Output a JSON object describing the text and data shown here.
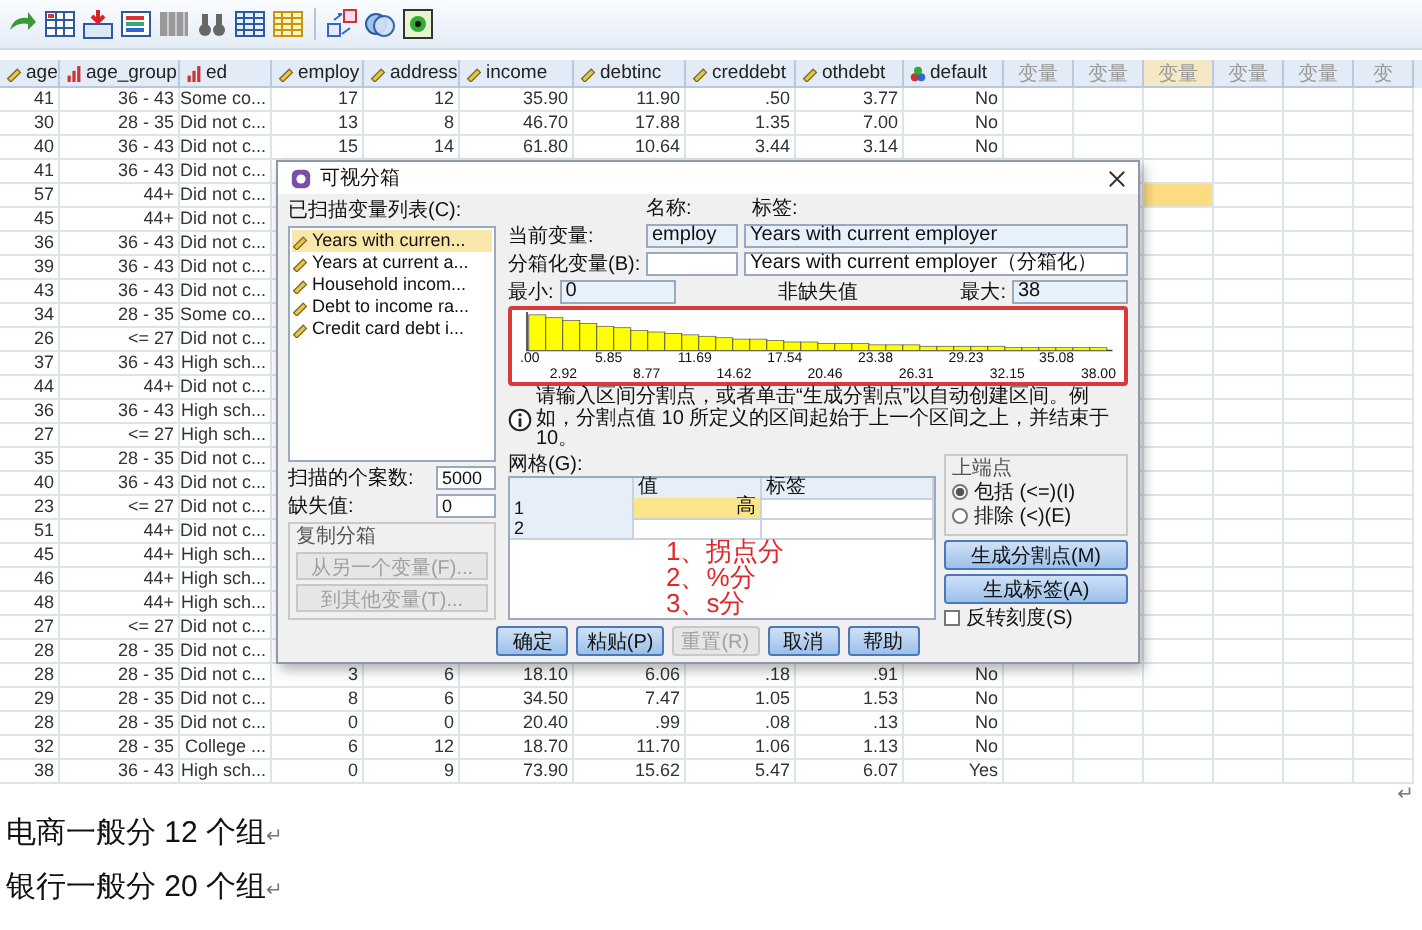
{
  "data_grid": {
    "columns": [
      {
        "name": "age",
        "kind": "scale"
      },
      {
        "name": "age_group",
        "kind": "ordinal"
      },
      {
        "name": "ed",
        "kind": "ordinal"
      },
      {
        "name": "employ",
        "kind": "scale"
      },
      {
        "name": "address",
        "kind": "scale"
      },
      {
        "name": "income",
        "kind": "scale"
      },
      {
        "name": "debtinc",
        "kind": "scale"
      },
      {
        "name": "creddebt",
        "kind": "scale"
      },
      {
        "name": "othdebt",
        "kind": "scale"
      },
      {
        "name": "default",
        "kind": "nominal"
      },
      {
        "name": "变量",
        "kind": "blank",
        "cursor": false
      },
      {
        "name": "变量",
        "kind": "blank",
        "cursor": false
      },
      {
        "name": "变量",
        "kind": "blank",
        "cursor": true
      },
      {
        "name": "变量",
        "kind": "blank",
        "cursor": false
      },
      {
        "name": "变量",
        "kind": "blank",
        "cursor": false
      },
      {
        "name": "变",
        "kind": "blank",
        "cursor": false
      }
    ],
    "rows": [
      {
        "cells": [
          "41",
          "36 - 43",
          "Some co...",
          "17",
          "12",
          "35.90",
          "11.90",
          ".50",
          "3.77",
          "No"
        ],
        "cursor": false
      },
      {
        "cells": [
          "30",
          "28 - 35",
          "Did not c...",
          "13",
          "8",
          "46.70",
          "17.88",
          "1.35",
          "7.00",
          "No"
        ],
        "cursor": false
      },
      {
        "cells": [
          "40",
          "36 - 43",
          "Did not c...",
          "15",
          "14",
          "61.80",
          "10.64",
          "3.44",
          "3.14",
          "No"
        ],
        "cursor": false
      },
      {
        "cells": [
          "41",
          "36 - 43",
          "Did not c..."
        ],
        "cursor": false
      },
      {
        "cells": [
          "57",
          "44+",
          "Did not c..."
        ],
        "cursor": true
      },
      {
        "cells": [
          "45",
          "44+",
          "Did not c..."
        ],
        "cursor": false
      },
      {
        "cells": [
          "36",
          "36 - 43",
          "Did not c..."
        ],
        "cursor": false
      },
      {
        "cells": [
          "39",
          "36 - 43",
          "Did not c..."
        ],
        "cursor": false
      },
      {
        "cells": [
          "43",
          "36 - 43",
          "Did not c..."
        ],
        "cursor": false
      },
      {
        "cells": [
          "34",
          "28 - 35",
          "Some co..."
        ],
        "cursor": false
      },
      {
        "cells": [
          "26",
          "<= 27",
          "Did not c..."
        ],
        "cursor": false
      },
      {
        "cells": [
          "37",
          "36 - 43",
          "High sch..."
        ],
        "cursor": false
      },
      {
        "cells": [
          "44",
          "44+",
          "Did not c..."
        ],
        "cursor": false
      },
      {
        "cells": [
          "36",
          "36 - 43",
          "High sch..."
        ],
        "cursor": false
      },
      {
        "cells": [
          "27",
          "<= 27",
          "High sch..."
        ],
        "cursor": false
      },
      {
        "cells": [
          "35",
          "28 - 35",
          "Did not c..."
        ],
        "cursor": false
      },
      {
        "cells": [
          "40",
          "36 - 43",
          "Did not c..."
        ],
        "cursor": false
      },
      {
        "cells": [
          "23",
          "<= 27",
          "Did not c..."
        ],
        "cursor": false
      },
      {
        "cells": [
          "51",
          "44+",
          "Did not c..."
        ],
        "cursor": false
      },
      {
        "cells": [
          "45",
          "44+",
          "High sch..."
        ],
        "cursor": false
      },
      {
        "cells": [
          "46",
          "44+",
          "High sch..."
        ],
        "cursor": false
      },
      {
        "cells": [
          "48",
          "44+",
          "High sch..."
        ],
        "cursor": false
      },
      {
        "cells": [
          "27",
          "<= 27",
          "Did not c..."
        ],
        "cursor": false
      },
      {
        "cells": [
          "28",
          "28 - 35",
          "Did not c..."
        ],
        "cursor": false
      },
      {
        "cells": [
          "28",
          "28 - 35",
          "Did not c...",
          "3",
          "6",
          "18.10",
          "6.06",
          ".18",
          ".91",
          "No"
        ],
        "cursor": false
      },
      {
        "cells": [
          "29",
          "28 - 35",
          "Did not c...",
          "8",
          "6",
          "34.50",
          "7.47",
          "1.05",
          "1.53",
          "No"
        ],
        "cursor": false
      },
      {
        "cells": [
          "28",
          "28 - 35",
          "Did not c...",
          "0",
          "0",
          "20.40",
          ".99",
          ".08",
          ".13",
          "No"
        ],
        "cursor": false
      },
      {
        "cells": [
          "32",
          "28 - 35",
          "College ...",
          "6",
          "12",
          "18.70",
          "11.70",
          "1.06",
          "1.13",
          "No"
        ],
        "cursor": false
      },
      {
        "cells": [
          "38",
          "36 - 43",
          "High sch...",
          "0",
          "9",
          "73.90",
          "15.62",
          "5.47",
          "6.07",
          "Yes"
        ],
        "cursor": false
      }
    ]
  },
  "dialog": {
    "title": "可视分箱",
    "scanned_list": {
      "label": "已扫描变量列表(C):",
      "items": [
        {
          "text": "Years with curren...",
          "selected": true
        },
        {
          "text": "Years at current a...",
          "selected": false
        },
        {
          "text": "Household incom...",
          "selected": false
        },
        {
          "text": "Debt to income ra...",
          "selected": false
        },
        {
          "text": "Credit card debt i...",
          "selected": false
        }
      ]
    },
    "cases_scanned": {
      "label": "扫描的个案数:",
      "value": "5000"
    },
    "missing": {
      "label": "缺失值:",
      "value": "0"
    },
    "copy_bins": {
      "title": "复制分箱",
      "buttons": [
        {
          "label": "从另一个变量(F)...",
          "disabled": true
        },
        {
          "label": "到其他变量(T)...",
          "disabled": true
        }
      ]
    },
    "name_header": "名称:",
    "label_header": "标签:",
    "current": {
      "label": "当前变量:",
      "name": "employ",
      "var_label": "Years with current employer"
    },
    "binned": {
      "label": "分箱化变量(B):",
      "var_label": "Years with current employer（分箱化）"
    },
    "min": {
      "label": "最小:",
      "value": "0"
    },
    "nonmissing": "非缺失值",
    "max": {
      "label": "最大:",
      "value": "38"
    },
    "histogram": {
      "ticks": [
        ".00",
        "2.92",
        "5.85",
        "8.77",
        "11.69",
        "14.62",
        "17.54",
        "20.46",
        "23.38",
        "26.31",
        "29.23",
        "32.15",
        "35.08",
        "38.00"
      ]
    },
    "info": "请输入区间分割点，或者单击“生成分割点”以自动创建区间。例如，分割点值 10 所定义的区间起始于上一个区间之上，并结束于 10。",
    "grid": {
      "label": "网格(G):",
      "columns": [
        "值",
        "标签"
      ],
      "rows": [
        {
          "number": "1",
          "value": "高",
          "selected": true
        },
        {
          "number": "2",
          "selected": false
        }
      ]
    },
    "annotations": [
      "1、拐点分",
      "2、%分",
      "3、s分"
    ],
    "upper_endpoint": {
      "title": "上端点",
      "options": [
        {
          "label": "包括 (<=)(I)",
          "selected": true
        },
        {
          "label": "排除 (<)(E)",
          "selected": false
        }
      ]
    },
    "side_buttons": [
      "生成分割点(M)",
      "生成标签(A)"
    ],
    "reverse": {
      "label": "反转刻度(S)",
      "checked": false
    },
    "buttons": [
      {
        "label": "确定",
        "disabled": false
      },
      {
        "label": "粘贴(P)",
        "disabled": false
      },
      {
        "label": "重置(R)",
        "disabled": true
      },
      {
        "label": "取消",
        "disabled": false
      },
      {
        "label": "帮助",
        "disabled": false
      }
    ]
  },
  "table_end_mark": "↵",
  "document_lines": [
    {
      "text": "电商一般分 12 个组",
      "mark": "↵"
    },
    {
      "text": "银行一般分 20 个组",
      "mark": "↵"
    }
  ]
}
